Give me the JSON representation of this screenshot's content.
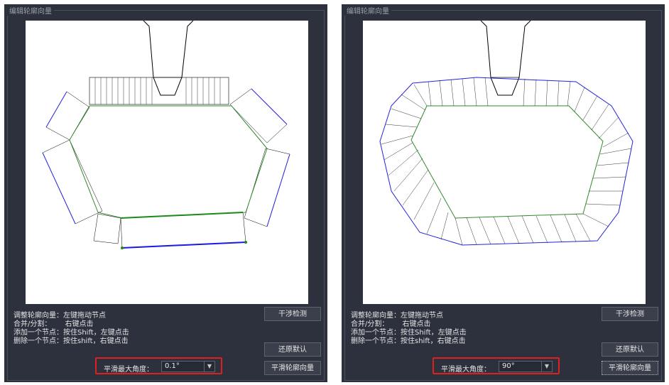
{
  "panels": [
    {
      "title": "编辑轮廓向量",
      "instructions": [
        {
          "label": "调整轮廓向量：",
          "value": "左键拖动节点"
        },
        {
          "label": "合并/分割：",
          "value": "右键点击"
        },
        {
          "label": "添加一个节点：",
          "value": "按住Shift，左键点击"
        },
        {
          "label": "删除一个节点：",
          "value": "按住shift，右键点击"
        }
      ],
      "interference_button": "干涉检测",
      "reset_button": "还原默认",
      "smooth_label": "平滑最大角度：",
      "smooth_value": "0.1°",
      "smooth_button": "平滑轮廓向量"
    },
    {
      "title": "编辑轮廓向量",
      "instructions": [
        {
          "label": "调整轮廓向量：",
          "value": "左键拖动节点"
        },
        {
          "label": "合并/分割：",
          "value": "右键点击"
        },
        {
          "label": "添加一个节点：",
          "value": "按住Shift，左键点击"
        },
        {
          "label": "删除一个节点：",
          "value": "按住shift，右键点击"
        }
      ],
      "interference_button": "干涉检测",
      "reset_button": "还原默认",
      "smooth_label": "平滑最大角度：",
      "smooth_value": "90°",
      "smooth_button": "平滑轮廓向量"
    }
  ],
  "colors": {
    "panel_bg": "#2c313d",
    "inner_contour": "#2e8b2e",
    "outer_contour": "#2323e0",
    "vector_lines": "#000000",
    "highlight": "#e0201e"
  }
}
